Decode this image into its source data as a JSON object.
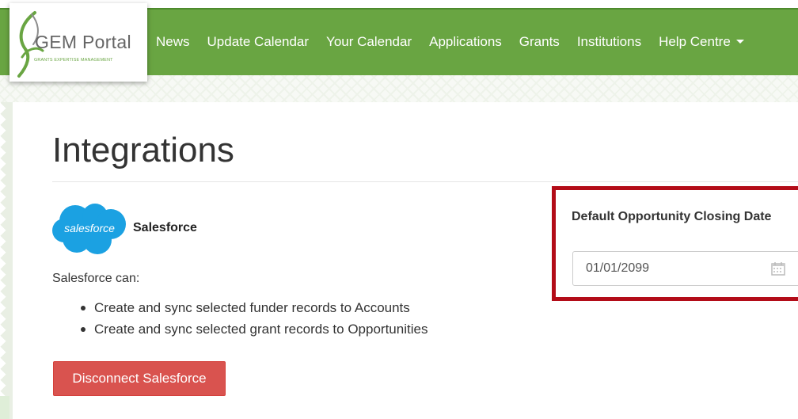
{
  "logo": {
    "name": "GEM Portal",
    "tagline": "GRANTS EXPERTISE MANAGEMENT"
  },
  "nav": {
    "items": [
      {
        "label": "News"
      },
      {
        "label": "Update Calendar"
      },
      {
        "label": "Your Calendar"
      },
      {
        "label": "Applications"
      },
      {
        "label": "Grants"
      },
      {
        "label": "Institutions"
      },
      {
        "label": "Help Centre",
        "dropdown": true
      }
    ]
  },
  "page": {
    "title": "Integrations"
  },
  "salesforce": {
    "logo_text": "salesforce",
    "name": "Salesforce",
    "intro": "Salesforce can:",
    "capabilities": [
      "Create and sync selected funder records to Accounts",
      "Create and sync selected grant records to Opportunities"
    ],
    "disconnect_label": "Disconnect Salesforce"
  },
  "closing_date": {
    "label": "Default Opportunity Closing Date",
    "value": "01/01/2099"
  },
  "colors": {
    "nav_green": "#69a542",
    "danger": "#d9534f",
    "highlight": "#b30c18",
    "salesforce_blue": "#1ba1e2"
  },
  "icons": {
    "logo_swoosh": "gem-swoosh-icon",
    "salesforce": "salesforce-cloud-icon",
    "calendar": "calendar-icon",
    "dropdown": "chevron-down-icon"
  }
}
